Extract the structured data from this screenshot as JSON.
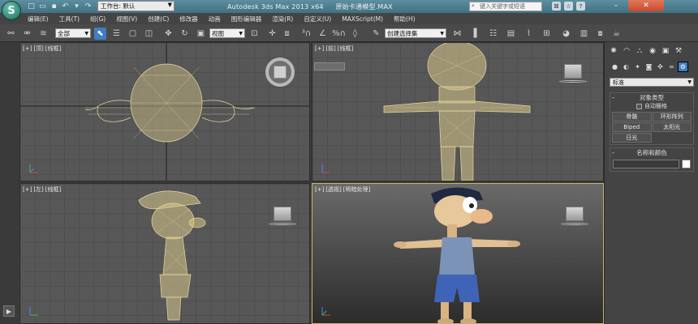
{
  "titlebar": {
    "app_logo": "S",
    "workspace_label": "工作台: 默认",
    "app_name": "Autodesk 3ds Max  2013 x64",
    "file_name": "原始卡通模型.MAX",
    "search_placeholder": "键入关键字或短语"
  },
  "menu": {
    "items": [
      "编辑(E)",
      "工具(T)",
      "组(G)",
      "视图(V)",
      "创建(C)",
      "修改器",
      "动画",
      "图形编辑器",
      "渲染(R)",
      "自定义(U)",
      "MAXScript(M)",
      "帮助(H)"
    ]
  },
  "toolbar": {
    "filter_value": "全部",
    "ref_coord_value": "视图",
    "named_selection_value": "创建选择集"
  },
  "viewports": {
    "top": {
      "label_1": "[+]",
      "label_2": "[顶]",
      "label_3": "[线框]"
    },
    "front": {
      "label_1": "[+]",
      "label_2": "[前]",
      "label_3": "[线框]"
    },
    "left": {
      "label_1": "[+]",
      "label_2": "[左]",
      "label_3": "[线框]"
    },
    "perspective": {
      "label_1": "[+]",
      "label_2": "[透视]",
      "label_3": "[明暗处理]"
    }
  },
  "command_panel": {
    "category_value": "标准",
    "object_type": {
      "title": "对象类型",
      "collapse": "-",
      "autogrid_label": "自动栅格",
      "buttons": [
        "骨骼",
        "环形阵列",
        "Biped",
        "太阳光",
        "日光"
      ]
    },
    "name_color": {
      "title": "名称和颜色",
      "collapse": "-"
    }
  },
  "colors": {
    "wireframe": "#e8d9a0",
    "active_tab": "#3d7fc1",
    "swatch": "#ffffff"
  }
}
